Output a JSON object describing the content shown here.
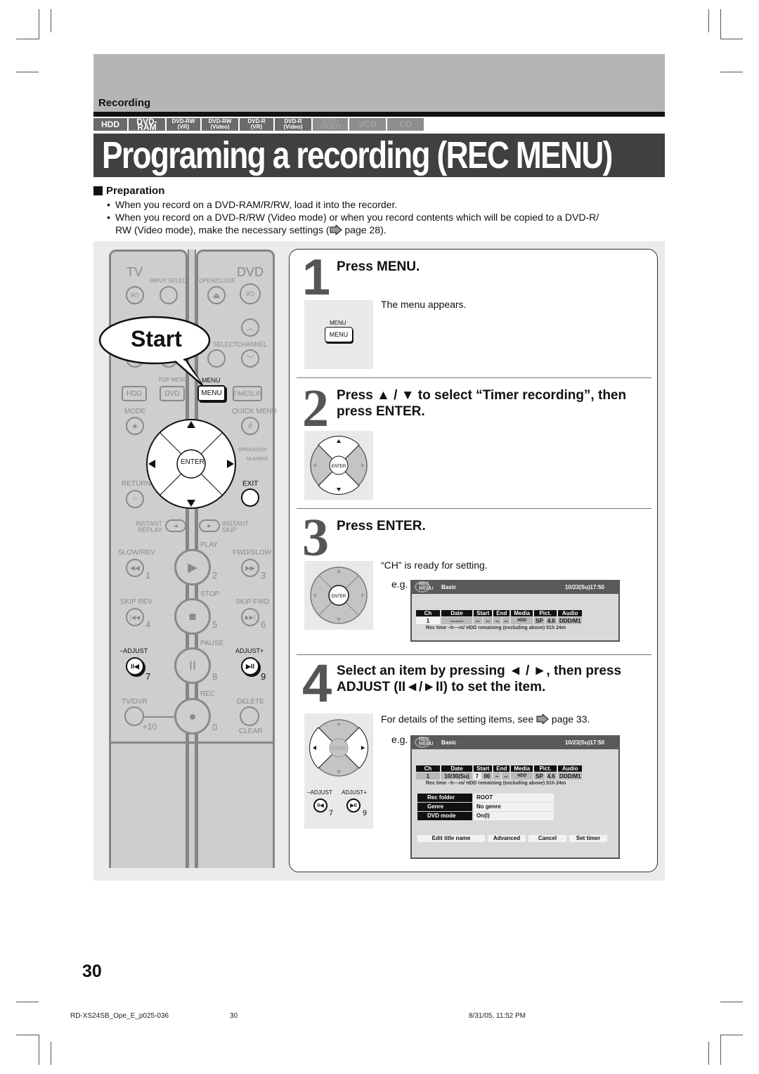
{
  "header": {
    "section": "Recording",
    "media_tabs": [
      {
        "label": "HDD",
        "active": true
      },
      {
        "label": "DVD-RAM",
        "active": true
      },
      {
        "label": "DVD-RW",
        "sub": "(VR)",
        "active": true
      },
      {
        "label": "DVD-RW",
        "sub": "(Video)",
        "active": true
      },
      {
        "label": "DVD-R",
        "sub": "(VR)",
        "active": true
      },
      {
        "label": "DVD-R",
        "sub": "(Video)",
        "active": true
      },
      {
        "label": "DVD-VIDEO",
        "active": false
      },
      {
        "label": "VCD",
        "active": false
      },
      {
        "label": "CD",
        "active": false
      }
    ],
    "title": "Programing a recording (REC MENU)"
  },
  "preparation": {
    "heading": "Preparation",
    "items": [
      "When you record on a DVD-RAM/R/RW, load it into the recorder.",
      "When you record on a DVD-R/RW (Video mode) or when you record contents which will be copied to a DVD-R/"
    ],
    "item2_line2_pre": "RW (Video mode), make the necessary settings (",
    "item2_line2_post": " page 28)."
  },
  "remote": {
    "start_label": "Start",
    "labels": {
      "tv": "TV",
      "dvd": "DVD",
      "input_select": "INPUT SELECT",
      "open_close": "OPEN/CLOSE",
      "power": "I/⏻",
      "eject": "⏏",
      "t_select": "T SELECT",
      "channel": "CHANNEL",
      "top_menu": "TOP MENU",
      "menu_top": "MENU",
      "hdd": "HDD",
      "dvd_btn": "DVD",
      "menu": "MENU",
      "timeslip": "TIMESLIP",
      "mode": "MODE",
      "quick_menu": "QUICK MENU",
      "operation": "OPERATION",
      "number": "NUMBER",
      "enter": "ENTER",
      "return": "RETURN",
      "exit": "EXIT",
      "instant_replay": "INSTANT\nREPLAY",
      "instant_skip": "INSTANT\nSKIP",
      "play": "PLAY",
      "slow_rev": "SLOW/REV",
      "fwd_slow": "FWD/SLOW",
      "stop": "STOP",
      "skip_rev": "SKIP REV",
      "skip_fwd": "SKIP FWD",
      "pause": "PAUSE",
      "adjust_minus": "−ADJUST",
      "adjust_plus": "ADJUST+",
      "rec": "REC",
      "tv_dvr": "TV/DVR",
      "delete": "DELETE",
      "clear": "CLEAR",
      "plus10": "+10"
    },
    "numbers": [
      "1",
      "2",
      "3",
      "4",
      "5",
      "6",
      "7",
      "8",
      "9",
      "0"
    ]
  },
  "steps": [
    {
      "num": "1",
      "title": "Press MENU.",
      "text": "The menu appears.",
      "key_caption": "MENU",
      "key_label": "MENU"
    },
    {
      "num": "2",
      "title_l1": "Press ▲ / ▼ to select “Timer recording”, then",
      "title_l2": "press ENTER.",
      "enter": "ENTER"
    },
    {
      "num": "3",
      "title": "Press ENTER.",
      "text": "“CH” is ready for setting.",
      "eg": "e.g.",
      "enter": "ENTER"
    },
    {
      "num": "4",
      "title_l1": "Select an item by pressing ◄ / ►, then press",
      "title_l2": "ADJUST (II◄/►II) to set the item.",
      "text_pre": "For details of the setting items, see ",
      "text_post": " page 33.",
      "eg": "e.g.",
      "enter": "ENTER",
      "adj_minus": "−ADJUST",
      "adj_plus": "ADJUST+",
      "n7": "7",
      "n9": "9"
    }
  ],
  "osd": {
    "logo": "REC MENU",
    "tab": "Basic",
    "datetime": "10/23(Su)17:50",
    "columns": [
      "Ch",
      "Date",
      "Start",
      "End",
      "Media",
      "Pict.",
      "Audio"
    ],
    "row_step3": [
      "1",
      "-------",
      "--",
      "--",
      "--",
      "--",
      "HDD",
      "SP",
      "4.6",
      "DDD/M1"
    ],
    "row_step4": [
      "1",
      "10/30(Su)",
      "7",
      "00",
      "–",
      "--",
      "HDD",
      "SP",
      "4.6",
      "DDD/M1"
    ],
    "remaining": "Rec time –h––m/ HDD remaining (excluding above)    51h 24m",
    "settings": [
      {
        "key": "Rec folder",
        "value": "ROOT"
      },
      {
        "key": "Genre",
        "value": "No genre"
      },
      {
        "key": "DVD mode",
        "value": "On(I)"
      }
    ],
    "buttons": [
      "Edit title name",
      "Advanced",
      "Cancel",
      "Set timer"
    ]
  },
  "footer": {
    "page_number": "30",
    "file": "RD-XS24SB_Ope_E_p025-036",
    "page": "30",
    "timestamp": "8/31/05, 11:52 PM"
  }
}
